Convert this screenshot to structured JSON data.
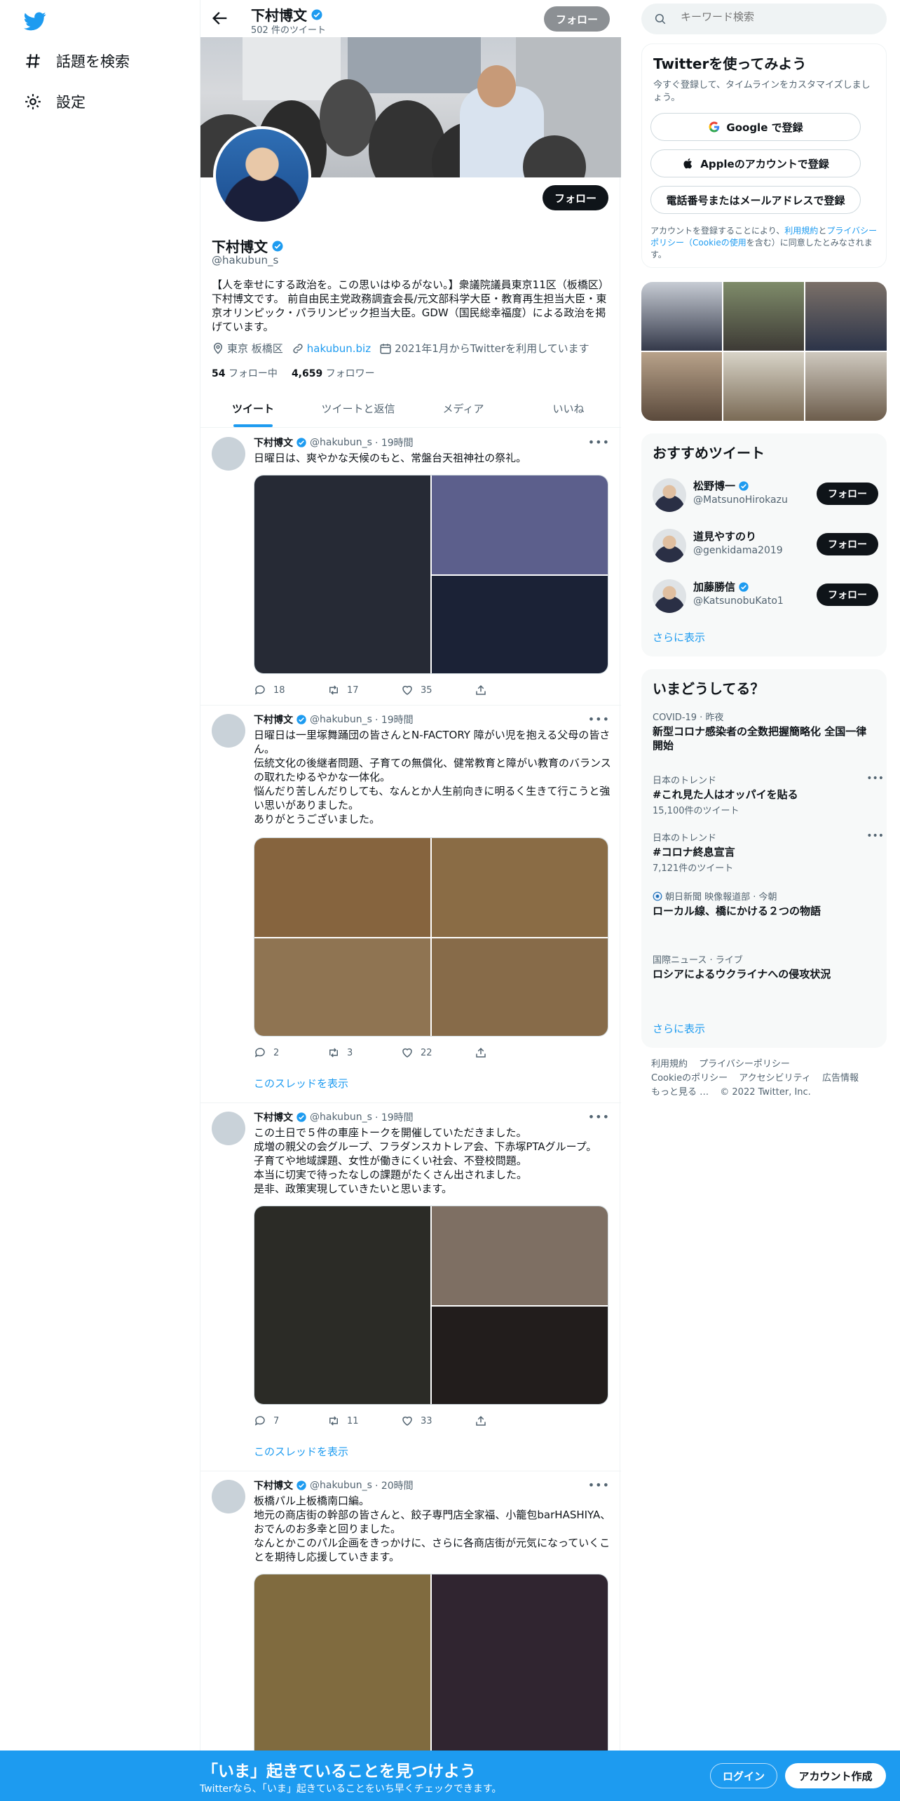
{
  "nav": {
    "items": [
      {
        "label": "話題を検索",
        "icon": "hashtag-icon"
      },
      {
        "label": "設定",
        "icon": "gear-icon"
      }
    ]
  },
  "colors": {
    "accent": "#1d9bf0",
    "text": "#0f1419",
    "muted": "#536471"
  },
  "topbar": {
    "name": "下村博文",
    "tweet_count": "502 件のツイート",
    "follow_label": "フォロー"
  },
  "profile": {
    "name": "下村博文",
    "handle": "@hakubun_s",
    "follow_label": "フォロー",
    "bio": "【人を幸せにする政治を。この思いはゆるがない。】衆議院議員東京11区（板橋区）下村博文です。 前自由民主党政務調査会長/元文部科学大臣・教育再生担当大臣・東京オリンピック・パラリンピック担当大臣。GDW（国民総幸福度）による政治を掲げています。",
    "location": "東京 板橋区",
    "website": "hakubun.biz",
    "joined": "2021年1月からTwitterを利用しています",
    "following_count": "54",
    "following_label": "フォロー中",
    "followers_count": "4,659",
    "followers_label": "フォロワー"
  },
  "tabs": [
    {
      "label": "ツイート",
      "active": true
    },
    {
      "label": "ツイートと返信",
      "active": false
    },
    {
      "label": "メディア",
      "active": false
    },
    {
      "label": "いいね",
      "active": false
    }
  ],
  "tweets": [
    {
      "name": "下村博文",
      "handle": "@hakubun_s",
      "time": "· 19時間",
      "text": "日曜日は、爽やかな天候のもと、常盤台天祖神社の祭礼。",
      "replies": "18",
      "retweets": "17",
      "likes": "35",
      "thread_label": ""
    },
    {
      "name": "下村博文",
      "handle": "@hakubun_s",
      "time": "· 19時間",
      "text": "日曜日は一里塚舞踊団の皆さんとN-FACTORY 障がい児を抱える父母の皆さん。\n伝統文化の後継者問題、子育ての無償化、健常教育と障がい教育のバランスの取れたゆるやかな一体化。\n悩んだり苦しんだりしても、なんとか人生前向きに明るく生きて行こうと強い思いがありました。\nありがとうございました。",
      "replies": "2",
      "retweets": "3",
      "likes": "22",
      "thread_label": "このスレッドを表示"
    },
    {
      "name": "下村博文",
      "handle": "@hakubun_s",
      "time": "· 19時間",
      "text": "この土日で５件の車座トークを開催していただきました。\n成増の親父の会グループ、フラダンスカトレア会、下赤塚PTAグループ。\n子育てや地域課題、女性が働きにくい社会、不登校問題。\n本当に切実で待ったなしの課題がたくさん出されました。\n是非、政策実現していきたいと思います。",
      "replies": "7",
      "retweets": "11",
      "likes": "33",
      "thread_label": "このスレッドを表示"
    },
    {
      "name": "下村博文",
      "handle": "@hakubun_s",
      "time": "· 20時間",
      "text": "板橋パル上板橋南口編。\n地元の商店街の幹部の皆さんと、餃子専門店全家福、小籠包barHASHIYA、おでんのお多幸と回りました。\nなんとかこのパル企画をきっかけに、さらに各商店街が元気になっていくことを期待し応援していきます。",
      "replies": "",
      "retweets": "",
      "likes": "",
      "thread_label": ""
    }
  ],
  "search": {
    "placeholder": "キーワード検索"
  },
  "join": {
    "title": "Twitterを使ってみよう",
    "subtitle": "今すぐ登録して、タイムラインをカスタマイズしましょう。",
    "google": "Google で登録",
    "apple": "Appleのアカウントで登録",
    "phone": "電話番号またはメールアドレスで登録",
    "legal_pre": "アカウントを登録することにより、",
    "legal_terms": "利用規約",
    "legal_and": "と",
    "legal_privacy": "プライバシーポリシー（Cookieの使用",
    "legal_post": "を含む）に同意したとみなされます。"
  },
  "recommended": {
    "title": "おすすめツイート",
    "users": [
      {
        "name": "松野博一",
        "handle": "@MatsunoHirokazu",
        "verified": true,
        "follow": "フォロー"
      },
      {
        "name": "道見やすのり",
        "handle": "@genkidama2019",
        "verified": false,
        "follow": "フォロー"
      },
      {
        "name": "加藤勝信",
        "handle": "@KatsunobuKato1",
        "verified": true,
        "follow": "フォロー"
      }
    ],
    "more": "さらに表示"
  },
  "trends": {
    "title": "いまどうしてる？",
    "items": [
      {
        "context": "COVID-19 · 昨夜",
        "title": "新型コロナ感染者の全数把握簡略化 全国一律開始",
        "count": ""
      },
      {
        "context": "日本のトレンド",
        "title": "#これ見た人はオッパイを貼る",
        "count": "15,100件のツイート"
      },
      {
        "context": "日本のトレンド",
        "title": "#コロナ終息宣言",
        "count": "7,121件のツイート"
      },
      {
        "context": "朝日新聞 映像報道部 · 今朝",
        "title": "ローカル線、橋にかける２つの物語",
        "count": ""
      },
      {
        "context": "国際ニュース · ライブ",
        "title": "ロシアによるウクライナへの侵攻状況",
        "count": ""
      }
    ],
    "more": "さらに表示"
  },
  "footer": {
    "links": [
      "利用規約",
      "プライバシーポリシー",
      "Cookieのポリシー",
      "アクセシビリティ",
      "広告情報",
      "もっと見る …",
      "© 2022 Twitter, Inc."
    ]
  },
  "bottom_bar": {
    "title": "「いま」起きていることを見つけよう",
    "subtitle": "Twitterなら、「いま」起きていることをいち早くチェックできます。",
    "login": "ログイン",
    "signup": "アカウント作成"
  }
}
